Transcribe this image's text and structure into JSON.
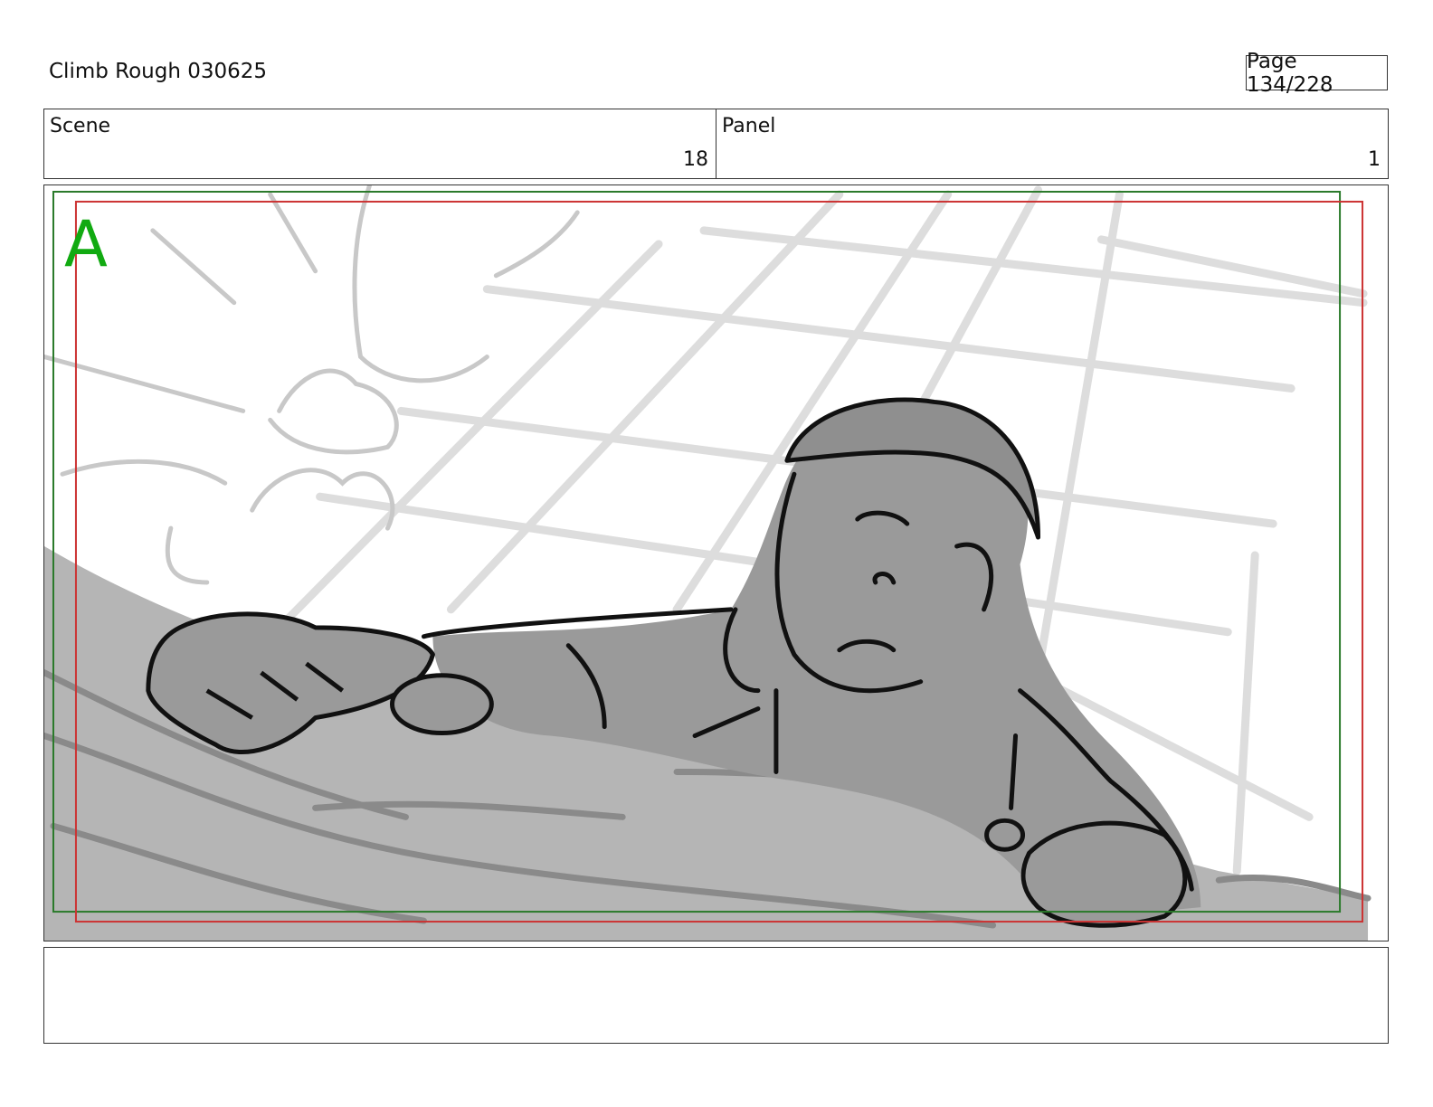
{
  "header": {
    "title": "Climb Rough 030625",
    "page": "Page 134/228"
  },
  "info": {
    "scene_label": "Scene",
    "scene_value": "18",
    "panel_label": "Panel",
    "panel_value": "1"
  },
  "frame": {
    "panel_letter": "A",
    "colors": {
      "safe_area": "#2a7a2a",
      "action_area": "#cc3333",
      "letter": "#11aa11",
      "figure_fill": "#9a9a9a",
      "ledge_fill": "#b5b5b5",
      "sketch_line": "#dcdcdc"
    }
  },
  "notes": {
    "text": ""
  }
}
